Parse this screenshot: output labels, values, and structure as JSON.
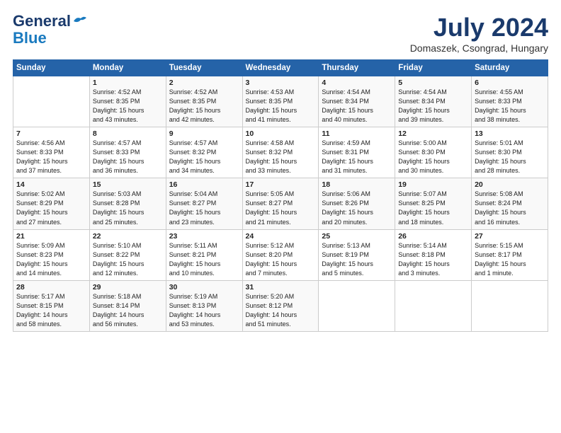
{
  "logo": {
    "general": "General",
    "blue": "Blue"
  },
  "title": "July 2024",
  "location": "Domaszek, Csongrad, Hungary",
  "days_of_week": [
    "Sunday",
    "Monday",
    "Tuesday",
    "Wednesday",
    "Thursday",
    "Friday",
    "Saturday"
  ],
  "weeks": [
    [
      {
        "day": "",
        "info": ""
      },
      {
        "day": "1",
        "info": "Sunrise: 4:52 AM\nSunset: 8:35 PM\nDaylight: 15 hours\nand 43 minutes."
      },
      {
        "day": "2",
        "info": "Sunrise: 4:52 AM\nSunset: 8:35 PM\nDaylight: 15 hours\nand 42 minutes."
      },
      {
        "day": "3",
        "info": "Sunrise: 4:53 AM\nSunset: 8:35 PM\nDaylight: 15 hours\nand 41 minutes."
      },
      {
        "day": "4",
        "info": "Sunrise: 4:54 AM\nSunset: 8:34 PM\nDaylight: 15 hours\nand 40 minutes."
      },
      {
        "day": "5",
        "info": "Sunrise: 4:54 AM\nSunset: 8:34 PM\nDaylight: 15 hours\nand 39 minutes."
      },
      {
        "day": "6",
        "info": "Sunrise: 4:55 AM\nSunset: 8:33 PM\nDaylight: 15 hours\nand 38 minutes."
      }
    ],
    [
      {
        "day": "7",
        "info": "Sunrise: 4:56 AM\nSunset: 8:33 PM\nDaylight: 15 hours\nand 37 minutes."
      },
      {
        "day": "8",
        "info": "Sunrise: 4:57 AM\nSunset: 8:33 PM\nDaylight: 15 hours\nand 36 minutes."
      },
      {
        "day": "9",
        "info": "Sunrise: 4:57 AM\nSunset: 8:32 PM\nDaylight: 15 hours\nand 34 minutes."
      },
      {
        "day": "10",
        "info": "Sunrise: 4:58 AM\nSunset: 8:32 PM\nDaylight: 15 hours\nand 33 minutes."
      },
      {
        "day": "11",
        "info": "Sunrise: 4:59 AM\nSunset: 8:31 PM\nDaylight: 15 hours\nand 31 minutes."
      },
      {
        "day": "12",
        "info": "Sunrise: 5:00 AM\nSunset: 8:30 PM\nDaylight: 15 hours\nand 30 minutes."
      },
      {
        "day": "13",
        "info": "Sunrise: 5:01 AM\nSunset: 8:30 PM\nDaylight: 15 hours\nand 28 minutes."
      }
    ],
    [
      {
        "day": "14",
        "info": "Sunrise: 5:02 AM\nSunset: 8:29 PM\nDaylight: 15 hours\nand 27 minutes."
      },
      {
        "day": "15",
        "info": "Sunrise: 5:03 AM\nSunset: 8:28 PM\nDaylight: 15 hours\nand 25 minutes."
      },
      {
        "day": "16",
        "info": "Sunrise: 5:04 AM\nSunset: 8:27 PM\nDaylight: 15 hours\nand 23 minutes."
      },
      {
        "day": "17",
        "info": "Sunrise: 5:05 AM\nSunset: 8:27 PM\nDaylight: 15 hours\nand 21 minutes."
      },
      {
        "day": "18",
        "info": "Sunrise: 5:06 AM\nSunset: 8:26 PM\nDaylight: 15 hours\nand 20 minutes."
      },
      {
        "day": "19",
        "info": "Sunrise: 5:07 AM\nSunset: 8:25 PM\nDaylight: 15 hours\nand 18 minutes."
      },
      {
        "day": "20",
        "info": "Sunrise: 5:08 AM\nSunset: 8:24 PM\nDaylight: 15 hours\nand 16 minutes."
      }
    ],
    [
      {
        "day": "21",
        "info": "Sunrise: 5:09 AM\nSunset: 8:23 PM\nDaylight: 15 hours\nand 14 minutes."
      },
      {
        "day": "22",
        "info": "Sunrise: 5:10 AM\nSunset: 8:22 PM\nDaylight: 15 hours\nand 12 minutes."
      },
      {
        "day": "23",
        "info": "Sunrise: 5:11 AM\nSunset: 8:21 PM\nDaylight: 15 hours\nand 10 minutes."
      },
      {
        "day": "24",
        "info": "Sunrise: 5:12 AM\nSunset: 8:20 PM\nDaylight: 15 hours\nand 7 minutes."
      },
      {
        "day": "25",
        "info": "Sunrise: 5:13 AM\nSunset: 8:19 PM\nDaylight: 15 hours\nand 5 minutes."
      },
      {
        "day": "26",
        "info": "Sunrise: 5:14 AM\nSunset: 8:18 PM\nDaylight: 15 hours\nand 3 minutes."
      },
      {
        "day": "27",
        "info": "Sunrise: 5:15 AM\nSunset: 8:17 PM\nDaylight: 15 hours\nand 1 minute."
      }
    ],
    [
      {
        "day": "28",
        "info": "Sunrise: 5:17 AM\nSunset: 8:15 PM\nDaylight: 14 hours\nand 58 minutes."
      },
      {
        "day": "29",
        "info": "Sunrise: 5:18 AM\nSunset: 8:14 PM\nDaylight: 14 hours\nand 56 minutes."
      },
      {
        "day": "30",
        "info": "Sunrise: 5:19 AM\nSunset: 8:13 PM\nDaylight: 14 hours\nand 53 minutes."
      },
      {
        "day": "31",
        "info": "Sunrise: 5:20 AM\nSunset: 8:12 PM\nDaylight: 14 hours\nand 51 minutes."
      },
      {
        "day": "",
        "info": ""
      },
      {
        "day": "",
        "info": ""
      },
      {
        "day": "",
        "info": ""
      }
    ]
  ]
}
